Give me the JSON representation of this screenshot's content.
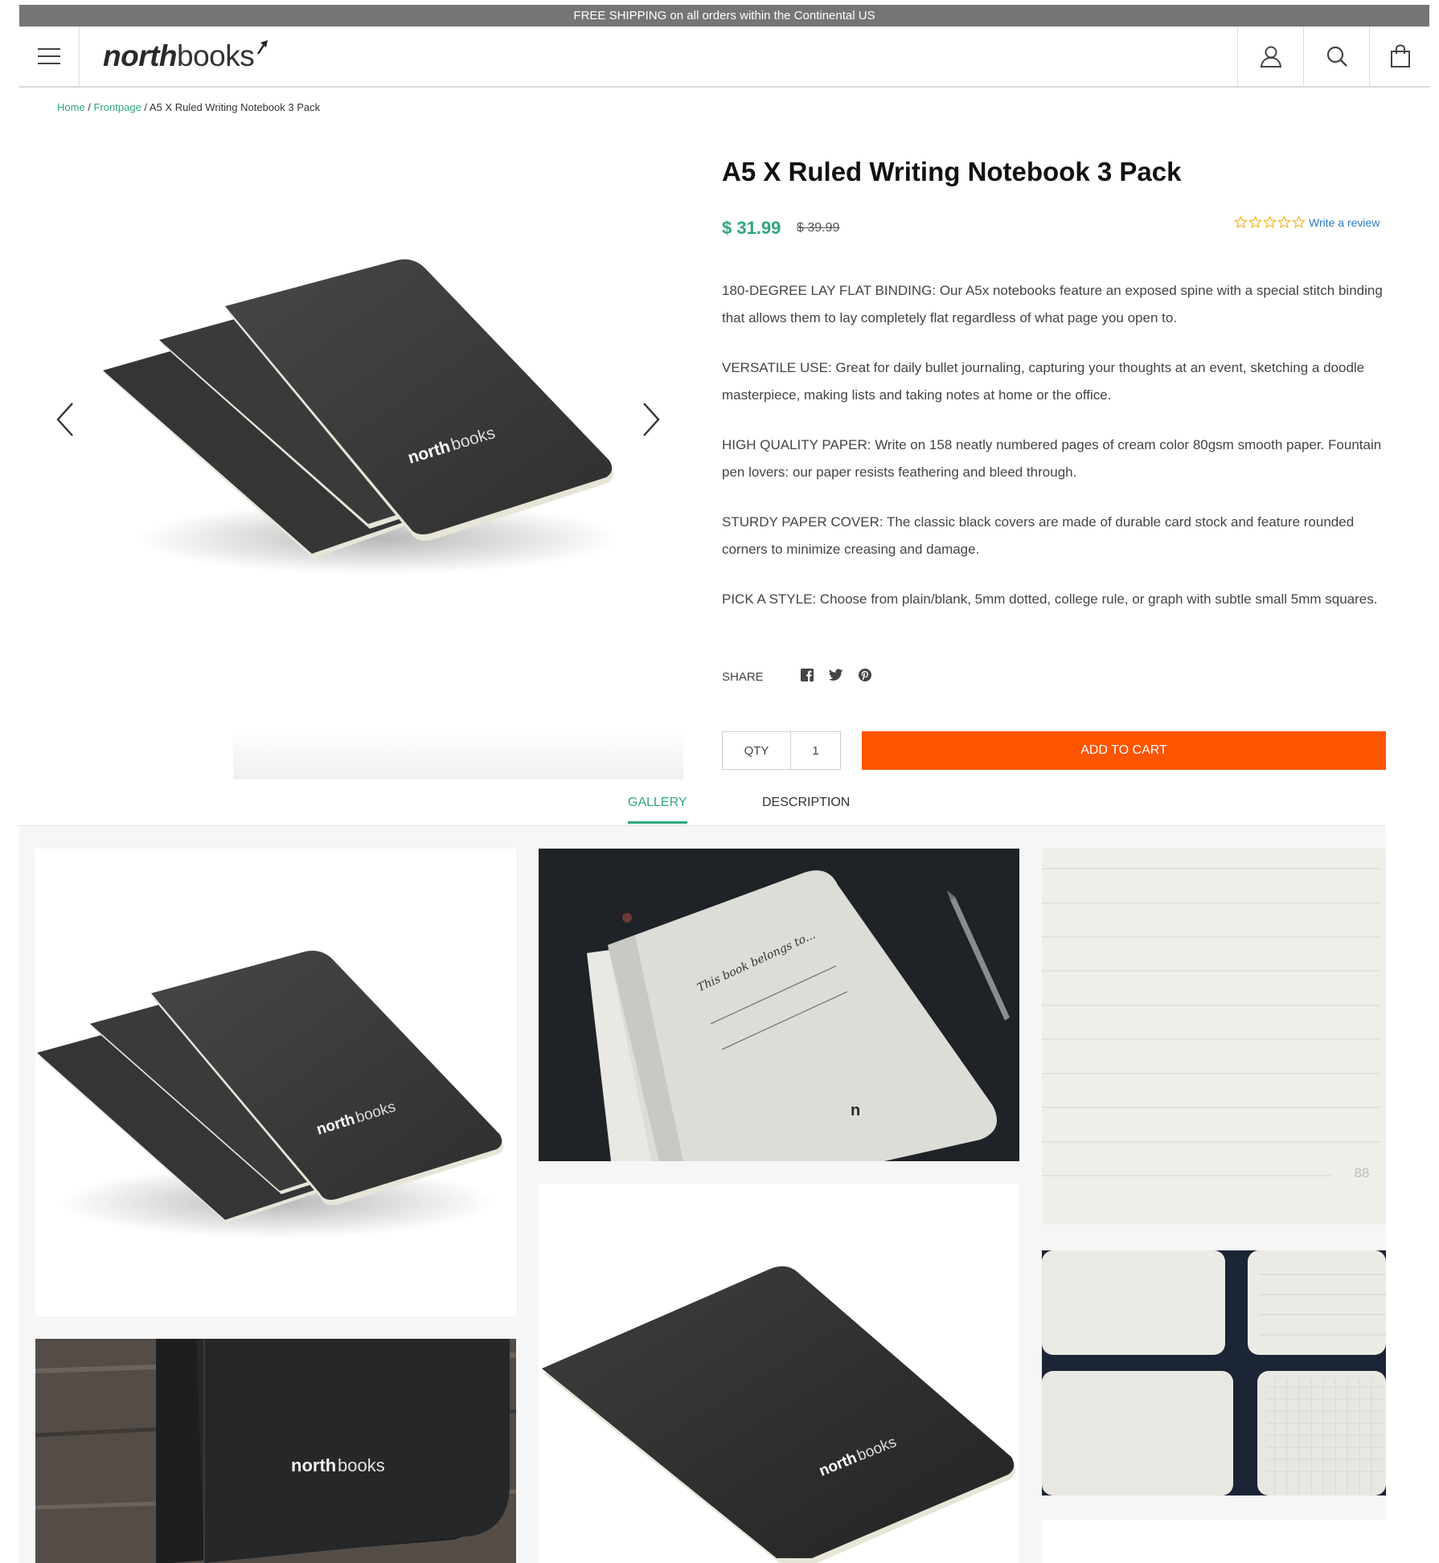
{
  "announcement": "FREE SHIPPING on all orders within the Continental US",
  "header": {
    "logo_bold": "north",
    "logo_light": "books"
  },
  "breadcrumb": {
    "home": "Home",
    "sep1": " / ",
    "frontpage": "Frontpage",
    "sep2": " / ",
    "current": "A5 X Ruled Writing Notebook 3 Pack"
  },
  "product": {
    "title": "A5 X Ruled Writing Notebook 3 Pack",
    "price": "$ 31.99",
    "compare_price": "$ 39.99",
    "rating": 0,
    "rating_max": 5,
    "write_review": "Write a review",
    "cover_logo_bold": "north",
    "cover_logo_light": "books",
    "description": [
      "180-DEGREE LAY FLAT BINDING: Our A5x notebooks feature an exposed spine with a special stitch binding that allows them to lay completely flat regardless of what page you open to.",
      "VERSATILE USE: Great for daily bullet journaling, capturing your thoughts at an event, sketching a doodle masterpiece, making lists and taking notes at home or the office.",
      "HIGH QUALITY PAPER: Write on 158 neatly numbered pages of cream color 80gsm smooth paper. Fountain pen lovers: our paper resists feathering and bleed through.",
      "STURDY PAPER COVER: The classic black covers are made of durable card stock and feature rounded corners to minimize creasing and damage.",
      "PICK A STYLE: Choose from plain/blank, 5mm dotted, college rule, or graph with subtle small 5mm squares."
    ],
    "share_label": "SHARE",
    "share_icons": [
      "facebook-icon",
      "twitter-icon",
      "pinterest-icon"
    ],
    "qty_label": "QTY",
    "qty_value": "1",
    "add_to_cart": "ADD TO CART"
  },
  "tabs": {
    "gallery": "GALLERY",
    "description": "DESCRIPTION"
  },
  "gallery": {
    "page_number": "88",
    "handwriting": "This book belongs to..."
  },
  "colors": {
    "accent": "#2fa67e",
    "cta": "#ff5400",
    "announcement_bg": "#757575",
    "star": "#f5b82e",
    "review_link": "#2a7bc6"
  }
}
